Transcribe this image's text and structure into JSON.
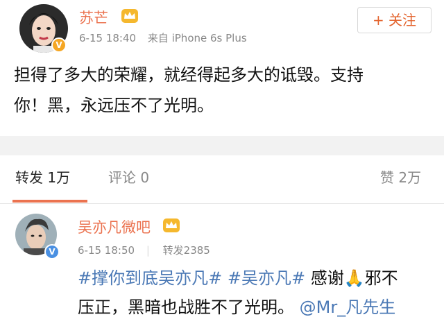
{
  "post": {
    "author": "苏芒",
    "time": "6-15 18:40",
    "source": "来自 iPhone 6s Plus",
    "follow_label": "+ 关注",
    "content_line1": "担得了多大的荣耀，就经得起多大的诋毁。支持",
    "content_line2": "你！黑，永远压不了光明。",
    "avatar_icon": "woman-portrait-avatar",
    "badge_icon": "verified-v-icon"
  },
  "tabs": {
    "repost": "转发 1万",
    "comment": "评论 0",
    "like": "赞 2万"
  },
  "repost": {
    "author": "吴亦凡微吧",
    "time": "6-15 18:50",
    "label": "转发2385",
    "hashtag1": "#撑你到底吴亦凡#",
    "hashtag2": "#吴亦凡#",
    "text1": "感谢",
    "emoji": "🙏",
    "text2": "邪不",
    "line2": "压正，黑暗也战胜不了光明。",
    "mention": "@Mr_凡先生",
    "avatar_icon": "man-portrait-avatar",
    "badge_icon": "verified-v-icon"
  },
  "colors": {
    "accent": "#eb7350",
    "link": "#4a78b5",
    "crown": "#f5b82e"
  }
}
